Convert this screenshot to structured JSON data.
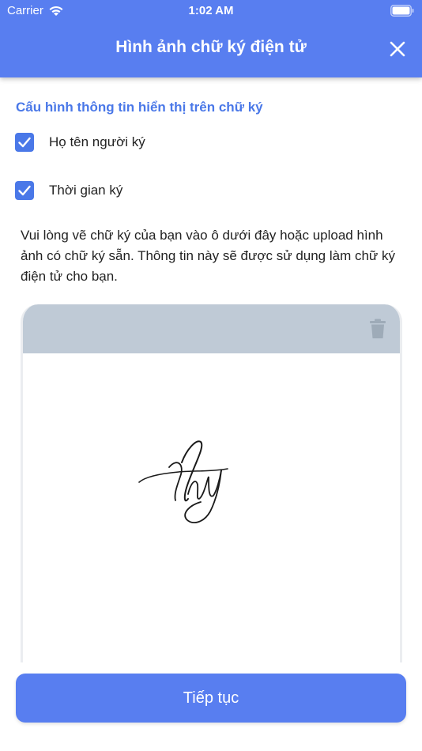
{
  "status_bar": {
    "carrier": "Carrier",
    "time": "1:02 AM"
  },
  "header": {
    "title": "Hình ảnh chữ ký điện tử",
    "close_icon": "close-icon"
  },
  "config": {
    "section_title": "Cấu hình thông tin hiển thị trên chữ ký",
    "options": [
      {
        "label": "Họ tên người ký",
        "checked": true
      },
      {
        "label": "Thời gian ký",
        "checked": true
      }
    ]
  },
  "instructions": "Vui lòng vẽ chữ ký của bạn vào ô dưới đây hoặc upload hình ảnh có chữ ký sẵn. Thông tin này sẽ được sử dụng làm chữ ký điện tử cho bạn.",
  "signature_pad": {
    "delete_icon": "trash-icon",
    "signature_icon": "handwritten-signature"
  },
  "footer": {
    "continue_label": "Tiếp tục"
  },
  "colors": {
    "primary": "#587ef0",
    "accent_text": "#4a78e8",
    "toolbar": "#bfcad6"
  }
}
